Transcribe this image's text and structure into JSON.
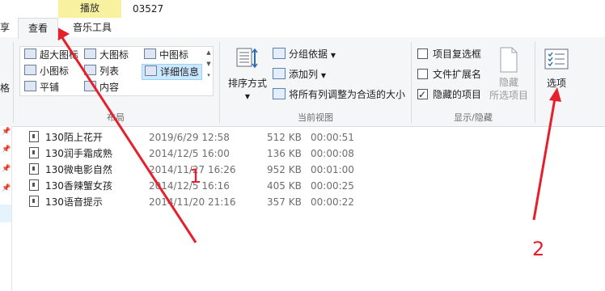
{
  "window": {
    "contextual_header": "播放",
    "title": "03527"
  },
  "tabs": {
    "cut_label": "享",
    "view_label": "查看",
    "music_label": "音乐工具"
  },
  "ribbon": {
    "left_stub": "格",
    "layout": {
      "group_label": "布局",
      "items": [
        {
          "label": "超大图标"
        },
        {
          "label": "大图标"
        },
        {
          "label": "中图标"
        },
        {
          "label": "小图标"
        },
        {
          "label": "列表"
        },
        {
          "label": "详细信息"
        },
        {
          "label": "平铺"
        },
        {
          "label": "内容"
        }
      ]
    },
    "current_view": {
      "group_label": "当前视图",
      "sort_label": "排序方式",
      "group_by_label": "分组依据",
      "add_column_label": "添加列",
      "fit_columns_label": "将所有列调整为合适的大小"
    },
    "show_hide": {
      "group_label": "显示/隐藏",
      "item_checkboxes_label": "项目复选框",
      "extensions_label": "文件扩展名",
      "hidden_items_label": "隐藏的项目",
      "hide_selected_label_1": "隐藏",
      "hide_selected_label_2": "所选项目"
    },
    "options_label": "选项"
  },
  "files": [
    {
      "name": "130陌上花开",
      "date": "2019/6/29 12:58",
      "size": "512 KB",
      "duration": "00:00:51"
    },
    {
      "name": "130润手霜成熟",
      "date": "2014/12/5 16:00",
      "size": "136 KB",
      "duration": "00:00:08"
    },
    {
      "name": "130微电影自然",
      "date": "2014/11/27 16:26",
      "size": "952 KB",
      "duration": "00:01:00"
    },
    {
      "name": "130香辣蟹女孩",
      "date": "2014/12/5 16:16",
      "size": "405 KB",
      "duration": "00:00:25"
    },
    {
      "name": "130语音提示",
      "date": "2014/11/20 21:16",
      "size": "357 KB",
      "duration": "00:00:22"
    }
  ],
  "annotations": {
    "one": "1",
    "two": "2"
  },
  "colors": {
    "annotation": "#e5202c",
    "context_header": "#f7f1a0",
    "ribbon_bg": "#f5f6f7",
    "selected": "#cce8ff"
  }
}
